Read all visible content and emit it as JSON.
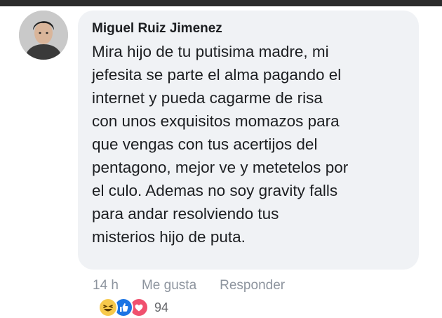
{
  "comment": {
    "author": "Miguel Ruiz Jimenez",
    "lines": [
      "Mira hijo de tu putisima madre, mi",
      "jefesita se parte el alma pagando el",
      "internet y pueda cagarme de risa",
      "con unos exquisitos momazos para",
      "que vengas con tus acertijos del",
      "pentagono, mejor ve y metetelos por",
      "el culo. Ademas no soy gravity falls",
      "para andar resolviendo tus",
      "misterios hijo de puta."
    ]
  },
  "actions": {
    "time": "14 h",
    "like_label": "Me gusta",
    "reply_label": "Responder"
  },
  "reactions": {
    "icons": [
      "haha-icon",
      "like-icon",
      "love-icon"
    ],
    "count": "94"
  },
  "colors": {
    "bubble": "#f0f2f5",
    "text": "#1c1e21",
    "meta": "#8d949e",
    "like_blue": "#1b74e4",
    "love_red": "#f0506e",
    "haha_yellow": "#f7c94b"
  }
}
